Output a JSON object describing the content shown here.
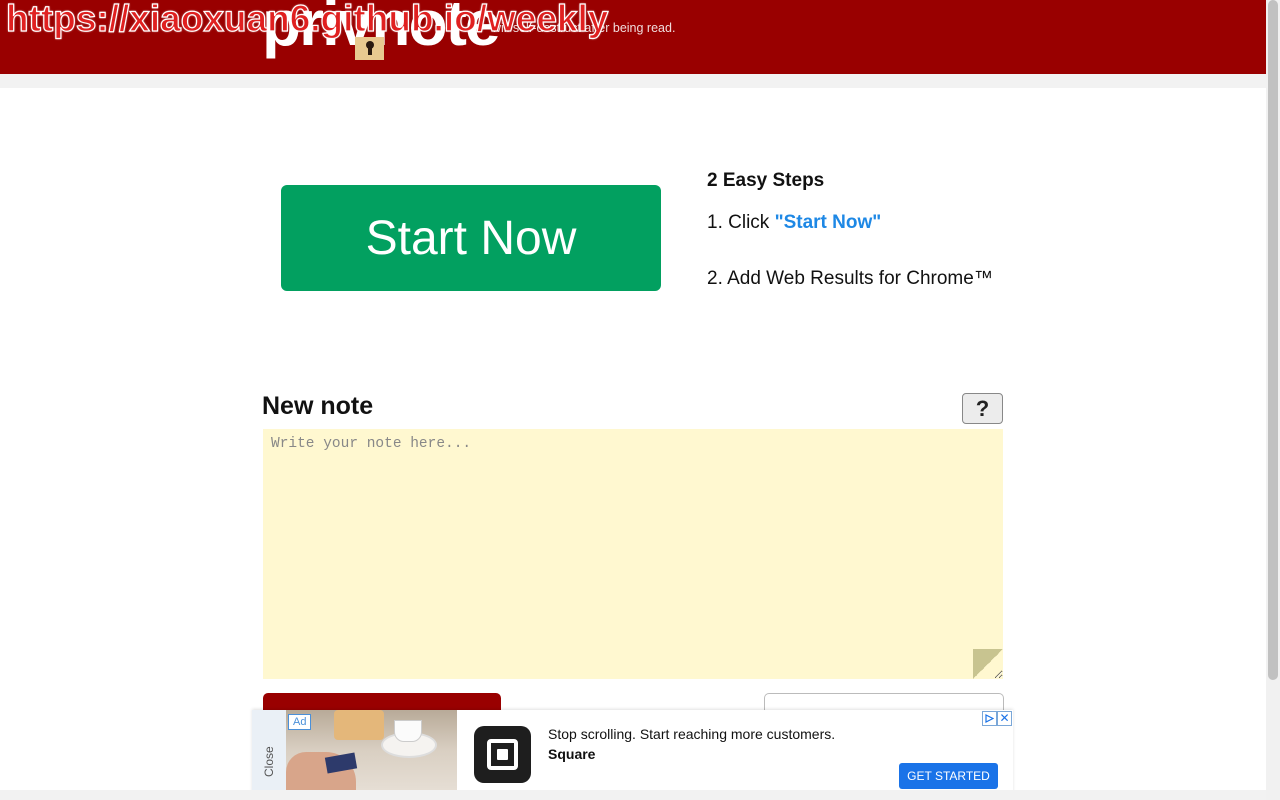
{
  "header": {
    "logo_text": "privnote",
    "tagline": "will self-destruct after being read.",
    "url_overlay": "https://xiaoxuan6.github.io/weekly"
  },
  "promo": {
    "button_label": "Start Now",
    "steps_title": "2 Easy Steps",
    "step1_prefix": "1. Click ",
    "step1_link": "\"Start Now\"",
    "step2": "2. Add Web Results for Chrome™"
  },
  "note": {
    "title": "New note",
    "help_label": "?",
    "placeholder": "Write your note here..."
  },
  "ad": {
    "close_label": "Close",
    "badge": "Ad",
    "headline": "Stop scrolling. Start reaching more customers.",
    "advertiser": "Square",
    "cta": "GET STARTED",
    "close_x": "✕"
  },
  "colors": {
    "brand_red": "#990000",
    "start_green": "#02a060",
    "link_blue": "#1e88e5",
    "note_bg": "#fff8d0",
    "ad_cta_blue": "#1a73e8"
  }
}
